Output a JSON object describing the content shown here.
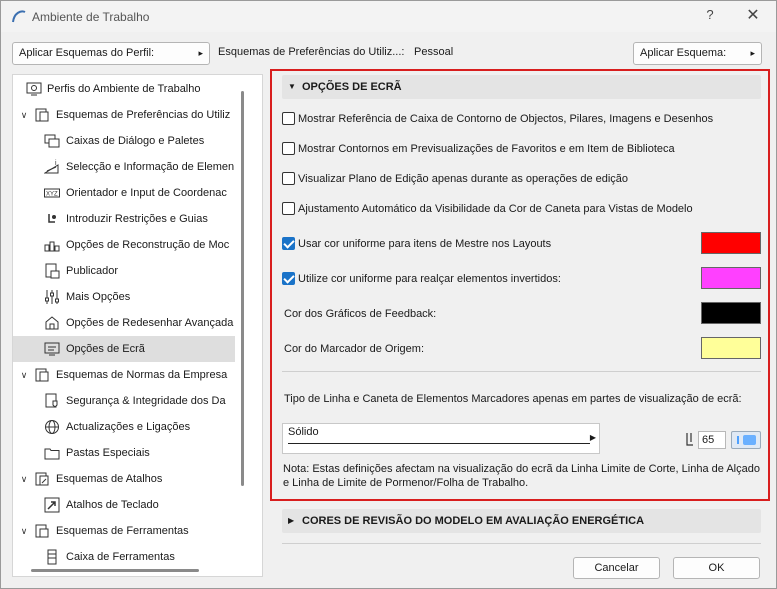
{
  "window": {
    "title": "Ambiente de Trabalho",
    "help_label": "?",
    "close_label": "✕"
  },
  "toolbar": {
    "apply_profile_label": "Aplicar Esquemas do Perfil:",
    "profile_label": "Esquemas de Preferências do Utiliz...:",
    "profile_value": "Pessoal",
    "apply_scheme_label": "Aplicar Esquema:"
  },
  "tree": {
    "items": [
      {
        "label": "Perfis do Ambiente de Trabalho",
        "chev": "",
        "icon": "profiles-icon"
      },
      {
        "label": "Esquemas de Preferências do Utiliz",
        "chev": "∨",
        "icon": "user-prefs-icon"
      },
      {
        "label": "Caixas de Diálogo e Paletes",
        "chev": "",
        "icon": "dialog-boxes-icon"
      },
      {
        "label": "Selecção e Informação de Elemen",
        "chev": "",
        "icon": "selection-info-icon"
      },
      {
        "label": "Orientador e Input de Coordenac",
        "chev": "",
        "icon": "coordinates-icon"
      },
      {
        "label": "Introduzir Restrições e Guias",
        "chev": "",
        "icon": "constraints-icon"
      },
      {
        "label": "Opções de Reconstrução de Moc",
        "chev": "",
        "icon": "rebuild-icon"
      },
      {
        "label": "Publicador",
        "chev": "",
        "icon": "publisher-icon"
      },
      {
        "label": "Mais Opções",
        "chev": "",
        "icon": "more-options-icon"
      },
      {
        "label": "Opções de Redesenhar Avançada",
        "chev": "",
        "icon": "redraw-icon"
      },
      {
        "label": "Opções de Ecrã",
        "chev": "",
        "icon": "screen-options-icon"
      },
      {
        "label": "Esquemas de Normas da Empresa",
        "chev": "∨",
        "icon": "company-standards-icon"
      },
      {
        "label": "Segurança & Integridade dos Da",
        "chev": "",
        "icon": "security-icon"
      },
      {
        "label": "Actualizações e Ligações",
        "chev": "",
        "icon": "globe-icon"
      },
      {
        "label": "Pastas Especiais",
        "chev": "",
        "icon": "folder-icon"
      },
      {
        "label": "Esquemas de Atalhos",
        "chev": "∨",
        "icon": "shortcut-schemes-icon"
      },
      {
        "label": "Atalhos de Teclado",
        "chev": "",
        "icon": "keyboard-shortcut-icon"
      },
      {
        "label": "Esquemas de Ferramentas",
        "chev": "∨",
        "icon": "tool-schemes-icon"
      },
      {
        "label": "Caixa de Ferramentas",
        "chev": "",
        "icon": "toolbox-icon"
      }
    ]
  },
  "display_options": {
    "section_title": "OPÇÕES DE ECRÃ",
    "checkboxes": [
      {
        "label": "Mostrar Referência de Caixa de Contorno de Objectos, Pilares, Imagens e Desenhos",
        "checked": false
      },
      {
        "label": "Mostrar Contornos em Previsualizações de Favoritos e em Item de Biblioteca",
        "checked": false
      },
      {
        "label": "Visualizar Plano de Edição apenas durante as operações de edição",
        "checked": false
      },
      {
        "label": "Ajustamento Automático da Visibilidade da Cor de Caneta para Vistas de Modelo",
        "checked": false
      }
    ],
    "uniform_master": {
      "label": "Usar cor uniforme para itens de Mestre nos Layouts",
      "checked": true,
      "color": "#ff0000"
    },
    "uniform_inverted": {
      "label": "Utilize cor uniforme para realçar elementos invertidos:",
      "checked": true,
      "color": "#ff40ff"
    },
    "feedback_color": {
      "label": "Cor dos Gráficos de Feedback:",
      "color": "#000000"
    },
    "origin_color": {
      "label": "Cor do Marcador de Origem:",
      "color": "#ffff99"
    },
    "line_type_label": "Tipo de Linha e Caneta de Elementos Marcadores apenas em partes de visualização de ecrã:",
    "line_type_value": "Sólido",
    "pen_number": "65",
    "pen_color": "#6ab0ff",
    "note": "Nota: Estas definições afectam na visualização do ecrã da Linha Limite de Corte, Linha de Alçado e Linha de Limite de Pormenor/Folha de Trabalho."
  },
  "energy_section": {
    "section_title": "CORES DE REVISÃO DO MODELO EM AVALIAÇÃO ENERGÉTICA"
  },
  "buttons": {
    "cancel": "Cancelar",
    "ok": "OK"
  },
  "colors": {
    "highlight_border": "#d81e1e",
    "selected_row": "#dedede",
    "checkbox_accent": "#1a73c8"
  }
}
